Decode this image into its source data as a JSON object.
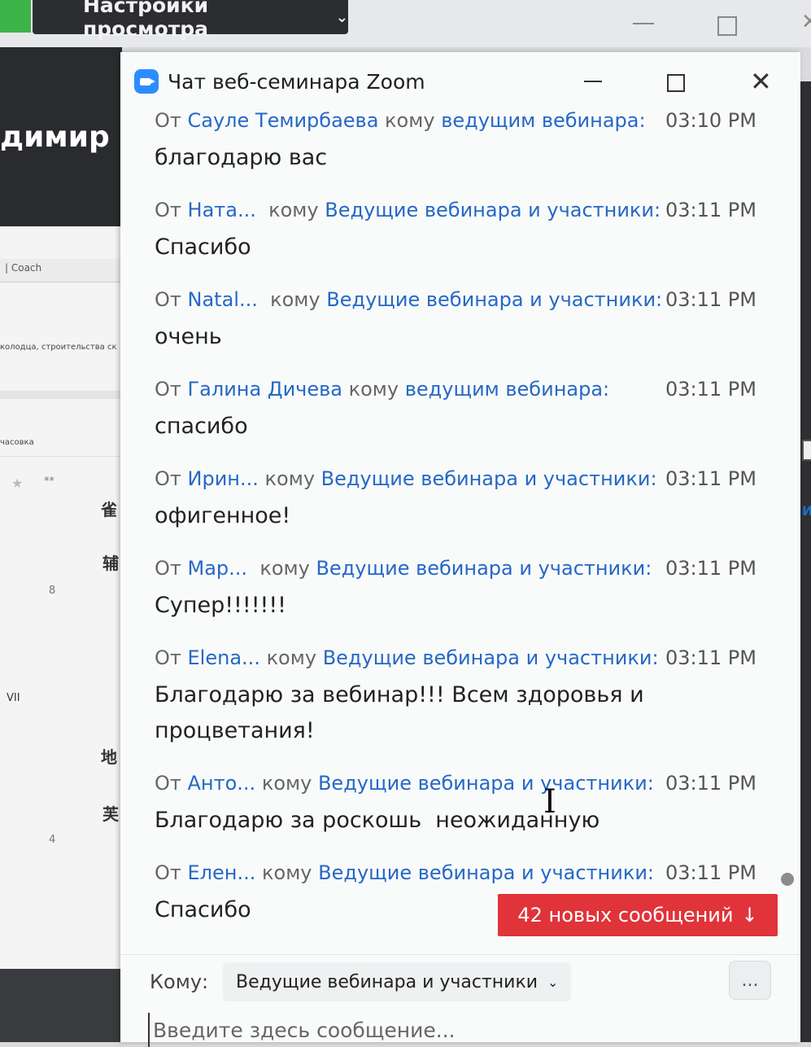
{
  "background": {
    "view_settings_label": "Настройки просмотра",
    "speaker_name": "димир З",
    "coach_label": "| Coach",
    "shared_line_1": "колодца, строительства ск",
    "shared_line_2": "часовка",
    "stars": "**",
    "glyphs": [
      "雀",
      "辅",
      "地",
      "芙"
    ],
    "numbers": [
      "8",
      "VII",
      "4"
    ]
  },
  "chat": {
    "title": "Чат веб-семинара Zoom",
    "messages": [
      {
        "from_prefix": "От",
        "sender": "Сауле Темирбаева",
        "to_word": "кому",
        "recipient": "ведущим вебинара:",
        "time": "03:10 PM",
        "text": "благодарю вас"
      },
      {
        "from_prefix": "От",
        "sender": "Ната...",
        "to_word": "кому",
        "recipient": "Ведущие вебинара и участники:",
        "time": "03:11 PM",
        "text": "Спасибо"
      },
      {
        "from_prefix": "От",
        "sender": "Natal...",
        "to_word": "кому",
        "recipient": "Ведущие вебинара и участники:",
        "time": "03:11 PM",
        "text": "очень"
      },
      {
        "from_prefix": "От",
        "sender": "Галина Дичева",
        "to_word": "кому",
        "recipient": "ведущим вебинара:",
        "time": "03:11 PM",
        "text": "спасибо"
      },
      {
        "from_prefix": "От",
        "sender": "Ирин...",
        "to_word": "кому",
        "recipient": "Ведущие вебинара и участники:",
        "time": "03:11 PM",
        "text": "офигенное!"
      },
      {
        "from_prefix": "От",
        "sender": "Мар...",
        "to_word": "кому",
        "recipient": "Ведущие вебинара и участники:",
        "time": "03:11 PM",
        "text": "Супер!!!!!!!"
      },
      {
        "from_prefix": "От",
        "sender": "Elena...",
        "to_word": "кому",
        "recipient": "Ведущие вебинара и участники:",
        "time": "03:11 PM",
        "text": "Благодарю за вебинар!!! Всем здоровья и процветания!"
      },
      {
        "from_prefix": "От",
        "sender": "Анто...",
        "to_word": "кому",
        "recipient": "Ведущие вебинара и участники:",
        "time": "03:11 PM",
        "text": "Благодарю за роскошь  неожиданную"
      },
      {
        "from_prefix": "От",
        "sender": "Елен...",
        "to_word": "кому",
        "recipient": "Ведущие вебинара и участники:",
        "time": "03:11 PM",
        "text": "Спасибо"
      }
    ],
    "new_messages_label": "42 новых сообщений",
    "to_label": "Кому:",
    "to_value": "Ведущие вебинара и участники",
    "more_label": "...",
    "input_placeholder": "Введите здесь сообщение..."
  }
}
